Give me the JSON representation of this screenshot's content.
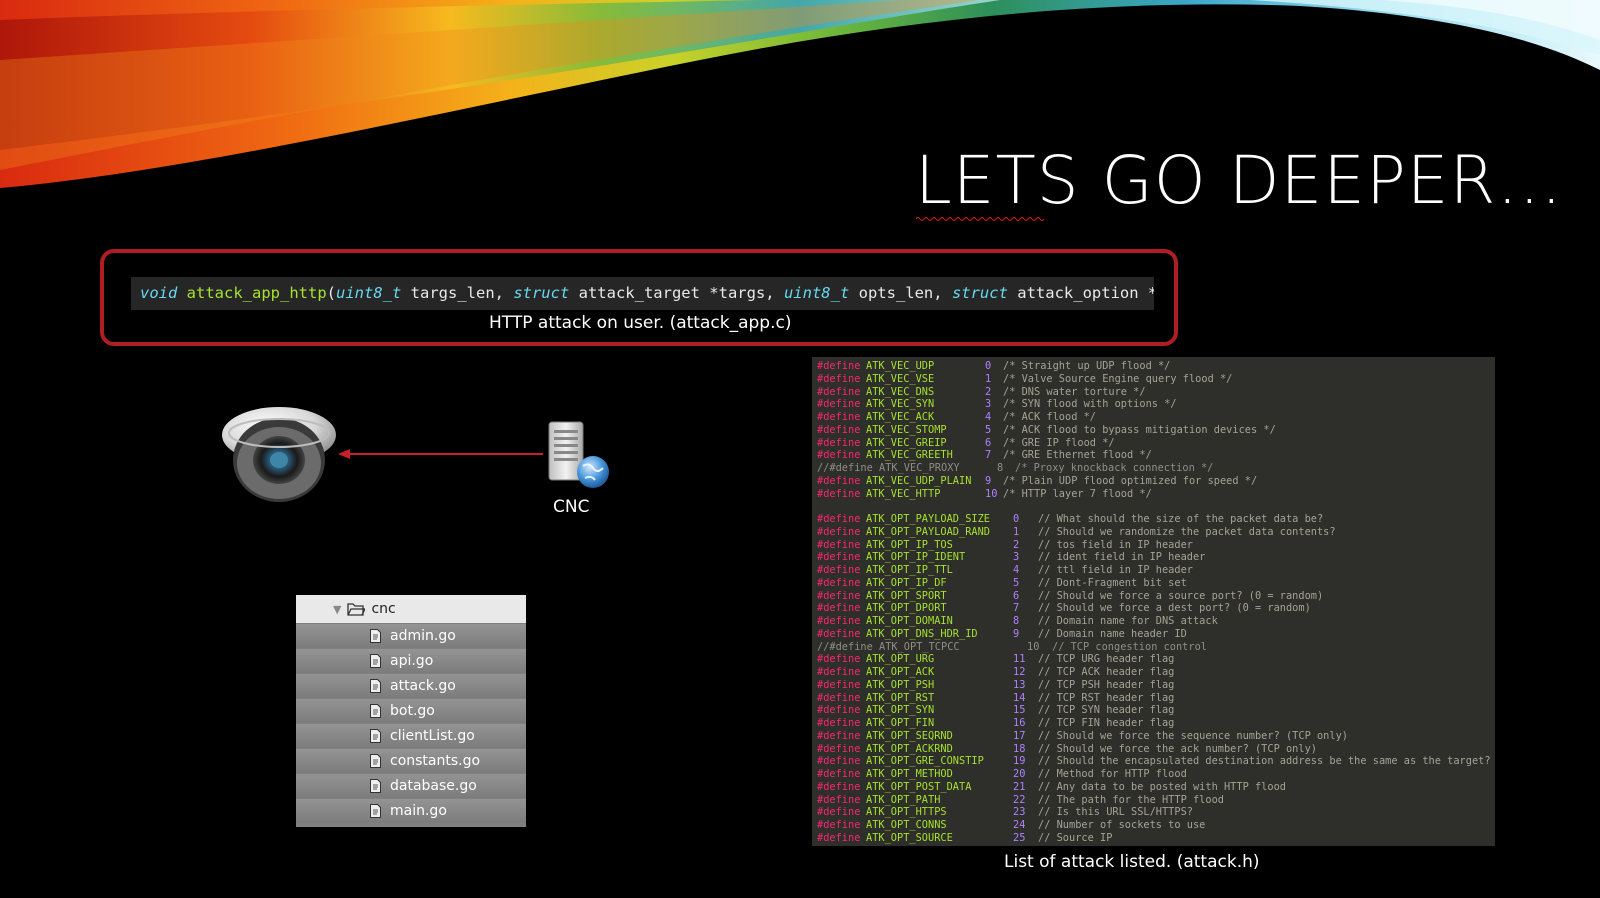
{
  "slide": {
    "title": "LETS GO DEEPER…",
    "signature": {
      "kw_void": "void",
      "fn_name": "attack_app_http",
      "open_paren": "(",
      "t1": "uint8_t",
      "p1": " targs_len, ",
      "kw_struct1": "struct",
      "p2": " attack_target *targs, ",
      "t2": "uint8_t",
      "p3": " opts_len, ",
      "kw_struct2": "struct",
      "p4": " attack_option *opts)",
      "caption": "HTTP attack on user. (attack_app.c)"
    },
    "diagram": {
      "cnc_label": "CNC"
    },
    "file_tree": {
      "folder": "cnc",
      "files": [
        "admin.go",
        "api.go",
        "attack.go",
        "bot.go",
        "clientList.go",
        "constants.go",
        "database.go",
        "main.go"
      ]
    },
    "attack_h": {
      "define_kw": "#define",
      "disabled_define": "//#define",
      "vectors": [
        {
          "name": "ATK_VEC_UDP",
          "num": "0",
          "comment": "/* Straight up UDP flood */"
        },
        {
          "name": "ATK_VEC_VSE",
          "num": "1",
          "comment": "/* Valve Source Engine query flood */"
        },
        {
          "name": "ATK_VEC_DNS",
          "num": "2",
          "comment": "/* DNS water torture */"
        },
        {
          "name": "ATK_VEC_SYN",
          "num": "3",
          "comment": "/* SYN flood with options */"
        },
        {
          "name": "ATK_VEC_ACK",
          "num": "4",
          "comment": "/* ACK flood */"
        },
        {
          "name": "ATK_VEC_STOMP",
          "num": "5",
          "comment": "/* ACK flood to bypass mitigation devices */"
        },
        {
          "name": "ATK_VEC_GREIP",
          "num": "6",
          "comment": "/* GRE IP flood */"
        },
        {
          "name": "ATK_VEC_GREETH",
          "num": "7",
          "comment": "/* GRE Ethernet flood */"
        },
        {
          "name": "ATK_VEC_PROXY",
          "num": "8",
          "comment": "/* Proxy knockback connection */",
          "disabled": true
        },
        {
          "name": "ATK_VEC_UDP_PLAIN",
          "num": "9",
          "comment": "/* Plain UDP flood optimized for speed */"
        },
        {
          "name": "ATK_VEC_HTTP",
          "num": "10",
          "comment": "/* HTTP layer 7 flood */"
        }
      ],
      "options": [
        {
          "name": "ATK_OPT_PAYLOAD_SIZE",
          "num": "0",
          "comment": "// What should the size of the packet data be?"
        },
        {
          "name": "ATK_OPT_PAYLOAD_RAND",
          "num": "1",
          "comment": "// Should we randomize the packet data contents?"
        },
        {
          "name": "ATK_OPT_IP_TOS",
          "num": "2",
          "comment": "// tos field in IP header"
        },
        {
          "name": "ATK_OPT_IP_IDENT",
          "num": "3",
          "comment": "// ident field in IP header"
        },
        {
          "name": "ATK_OPT_IP_TTL",
          "num": "4",
          "comment": "// ttl field in IP header"
        },
        {
          "name": "ATK_OPT_IP_DF",
          "num": "5",
          "comment": "// Dont-Fragment bit set"
        },
        {
          "name": "ATK_OPT_SPORT",
          "num": "6",
          "comment": "// Should we force a source port? (0 = random)"
        },
        {
          "name": "ATK_OPT_DPORT",
          "num": "7",
          "comment": "// Should we force a dest port? (0 = random)"
        },
        {
          "name": "ATK_OPT_DOMAIN",
          "num": "8",
          "comment": "// Domain name for DNS attack"
        },
        {
          "name": "ATK_OPT_DNS_HDR_ID",
          "num": "9",
          "comment": "// Domain name header ID"
        },
        {
          "name": "ATK_OPT_TCPCC",
          "num": "10",
          "comment": "// TCP congestion control",
          "disabled": true
        },
        {
          "name": "ATK_OPT_URG",
          "num": "11",
          "comment": "// TCP URG header flag"
        },
        {
          "name": "ATK_OPT_ACK",
          "num": "12",
          "comment": "// TCP ACK header flag"
        },
        {
          "name": "ATK_OPT_PSH",
          "num": "13",
          "comment": "// TCP PSH header flag"
        },
        {
          "name": "ATK_OPT_RST",
          "num": "14",
          "comment": "// TCP RST header flag"
        },
        {
          "name": "ATK_OPT_SYN",
          "num": "15",
          "comment": "// TCP SYN header flag"
        },
        {
          "name": "ATK_OPT_FIN",
          "num": "16",
          "comment": "// TCP FIN header flag"
        },
        {
          "name": "ATK_OPT_SEQRND",
          "num": "17",
          "comment": "// Should we force the sequence number? (TCP only)"
        },
        {
          "name": "ATK_OPT_ACKRND",
          "num": "18",
          "comment": "// Should we force the ack number? (TCP only)"
        },
        {
          "name": "ATK_OPT_GRE_CONSTIP",
          "num": "19",
          "comment": "// Should the encapsulated destination address be the same as the target?"
        },
        {
          "name": "ATK_OPT_METHOD",
          "num": "20",
          "comment": "// Method for HTTP flood"
        },
        {
          "name": "ATK_OPT_POST_DATA",
          "num": "21",
          "comment": "// Any data to be posted with HTTP flood"
        },
        {
          "name": "ATK_OPT_PATH",
          "num": "22",
          "comment": "// The path for the HTTP flood"
        },
        {
          "name": "ATK_OPT_HTTPS",
          "num": "23",
          "comment": "// Is this URL SSL/HTTPS?"
        },
        {
          "name": "ATK_OPT_CONNS",
          "num": "24",
          "comment": "// Number of sockets to use"
        },
        {
          "name": "ATK_OPT_SOURCE",
          "num": "25",
          "comment": "// Source IP"
        }
      ],
      "caption": "List of attack listed. (attack.h)"
    },
    "colors": {
      "box_border": "#b01e24",
      "define": "#f92672",
      "name": "#a6e22e",
      "number": "#ae81ff",
      "comment": "#a4a494",
      "keyword": "#66d9ef"
    }
  }
}
